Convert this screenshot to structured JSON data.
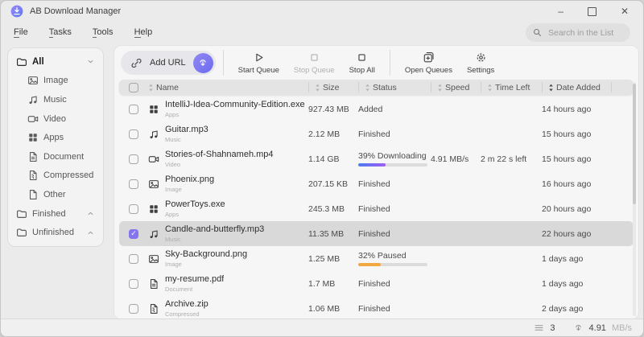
{
  "titlebar": {
    "app_title": "AB Download Manager"
  },
  "window_controls": {
    "minimize": "–",
    "close": "✕"
  },
  "glyphs": {
    "check": "✓"
  },
  "menubar": {
    "items": [
      {
        "first": "F",
        "rest": "ile"
      },
      {
        "first": "T",
        "rest": "asks"
      },
      {
        "first": "T",
        "rest": "ools"
      },
      {
        "first": "H",
        "rest": "elp"
      }
    ]
  },
  "search": {
    "placeholder": "Search in the List"
  },
  "toolbar": {
    "add_url_label": "Add URL",
    "groups": [
      [
        {
          "label": "Start Queue",
          "icon": "play",
          "enabled": true
        },
        {
          "label": "Stop Queue",
          "icon": "stop",
          "enabled": false
        },
        {
          "label": "Stop All",
          "icon": "stop",
          "enabled": true
        }
      ],
      [
        {
          "label": "Open Queues",
          "icon": "queues",
          "enabled": true
        },
        {
          "label": "Settings",
          "icon": "gear",
          "enabled": true
        }
      ]
    ]
  },
  "sidebar": {
    "items": [
      {
        "label": "All",
        "icon": "folder",
        "level": 0,
        "bold": true,
        "chevron": "down"
      },
      {
        "label": "Image",
        "icon": "image",
        "level": 1
      },
      {
        "label": "Music",
        "icon": "music",
        "level": 1
      },
      {
        "label": "Video",
        "icon": "video",
        "level": 1
      },
      {
        "label": "Apps",
        "icon": "apps",
        "level": 1
      },
      {
        "label": "Document",
        "icon": "document",
        "level": 1
      },
      {
        "label": "Compressed",
        "icon": "compressed",
        "level": 1
      },
      {
        "label": "Other",
        "icon": "other",
        "level": 1
      },
      {
        "label": "Finished",
        "icon": "folder",
        "level": 0,
        "chevron": "up"
      },
      {
        "label": "Unfinished",
        "icon": "folder",
        "level": 0,
        "chevron": "up"
      }
    ]
  },
  "table": {
    "headers": [
      {
        "label": "Name"
      },
      {
        "label": "Size"
      },
      {
        "label": "Status"
      },
      {
        "label": "Speed"
      },
      {
        "label": "Time Left"
      },
      {
        "label": "Date Added",
        "sorted": true
      }
    ],
    "rows": [
      {
        "name": "IntelliJ-Idea-Community-Edition.exe",
        "category": "Apps",
        "icon": "apps",
        "size": "927.43 MB",
        "status": "Added",
        "speed": "",
        "time_left": "",
        "date": "14 hours ago"
      },
      {
        "name": "Guitar.mp3",
        "category": "Music",
        "icon": "music",
        "size": "2.12 MB",
        "status": "Finished",
        "speed": "",
        "time_left": "",
        "date": "15 hours ago"
      },
      {
        "name": "Stories-of-Shahnameh.mp4",
        "category": "Video",
        "icon": "video",
        "size": "1.14 GB",
        "status": "39% Downloading",
        "speed": "4.91 MB/s",
        "time_left": "2 m 22 s left",
        "date": "15 hours ago",
        "progress": 39,
        "progress_kind": "downloading"
      },
      {
        "name": "Phoenix.png",
        "category": "Image",
        "icon": "image",
        "size": "207.15 KB",
        "status": "Finished",
        "speed": "",
        "time_left": "",
        "date": "16 hours ago"
      },
      {
        "name": "PowerToys.exe",
        "category": "Apps",
        "icon": "apps",
        "size": "245.3 MB",
        "status": "Finished",
        "speed": "",
        "time_left": "",
        "date": "20 hours ago"
      },
      {
        "name": "Candle-and-butterfly.mp3",
        "category": "Music",
        "icon": "music",
        "size": "11.35 MB",
        "status": "Finished",
        "speed": "",
        "time_left": "",
        "date": "22 hours ago",
        "selected": true
      },
      {
        "name": "Sky-Background.png",
        "category": "Image",
        "icon": "image",
        "size": "1.25 MB",
        "status": "32% Paused",
        "speed": "",
        "time_left": "",
        "date": "1 days ago",
        "progress": 32,
        "progress_kind": "paused"
      },
      {
        "name": "my-resume.pdf",
        "category": "Document",
        "icon": "document",
        "size": "1.7 MB",
        "status": "Finished",
        "speed": "",
        "time_left": "",
        "date": "1 days ago"
      },
      {
        "name": "Archive.zip",
        "category": "Compressed",
        "icon": "compressed",
        "size": "1.06 MB",
        "status": "Finished",
        "speed": "",
        "time_left": "",
        "date": "2 days ago"
      }
    ]
  },
  "statusbar": {
    "rows_count": "3",
    "speed": "4.91",
    "speed_unit": "MB/s"
  },
  "colors": {
    "accent": "#8474ee",
    "downloading_start": "#4a7cf0",
    "downloading_end": "#a15df6",
    "paused": "#f2a83e"
  }
}
